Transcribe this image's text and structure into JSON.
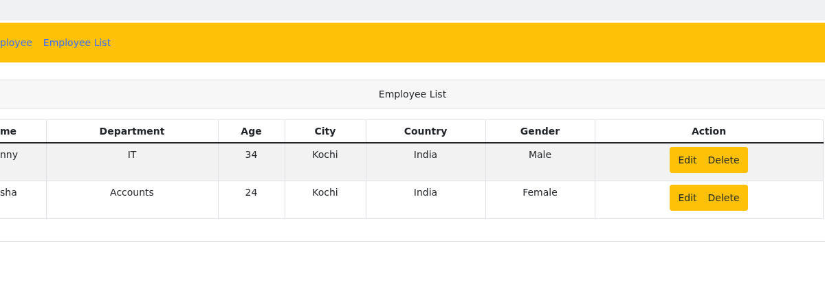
{
  "nav": {
    "links": [
      {
        "label": "ployee"
      },
      {
        "label": "Employee List"
      }
    ]
  },
  "card": {
    "title": "Employee List"
  },
  "table": {
    "columns": [
      "me",
      "Department",
      "Age",
      "City",
      "Country",
      "Gender",
      "Action"
    ],
    "rows": [
      {
        "cells": [
          "nny",
          "IT",
          "34",
          "Kochi",
          "India",
          "Male"
        ],
        "actions": [
          "Edit",
          "Delete"
        ]
      },
      {
        "cells": [
          "sha",
          "Accounts",
          "24",
          "Kochi",
          "India",
          "Female"
        ],
        "actions": [
          "Edit",
          "Delete"
        ]
      }
    ]
  }
}
